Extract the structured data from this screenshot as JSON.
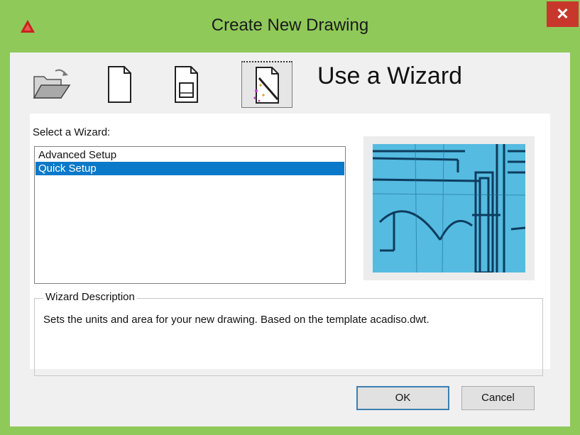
{
  "window": {
    "title": "Create New Drawing",
    "close_glyph": "✕",
    "app_icon": "autocad-logo-icon"
  },
  "modes": {
    "heading": "Use a Wizard",
    "buttons": [
      {
        "name": "open-drawing-icon",
        "active": false
      },
      {
        "name": "blank-drawing-icon",
        "active": false
      },
      {
        "name": "template-icon",
        "active": false
      },
      {
        "name": "wizard-icon",
        "active": true
      }
    ]
  },
  "wizard": {
    "select_label": "Select a Wizard:",
    "items": [
      {
        "label": "Advanced Setup",
        "selected": false
      },
      {
        "label": "Quick Setup",
        "selected": true
      }
    ]
  },
  "description": {
    "legend": "Wizard Description",
    "text": "Sets the units and area for your new drawing. Based on the template acadiso.dwt."
  },
  "buttons": {
    "ok": "OK",
    "cancel": "Cancel"
  },
  "colors": {
    "frame": "#8fc95a",
    "close": "#c7372c",
    "selection": "#0a79c9"
  }
}
